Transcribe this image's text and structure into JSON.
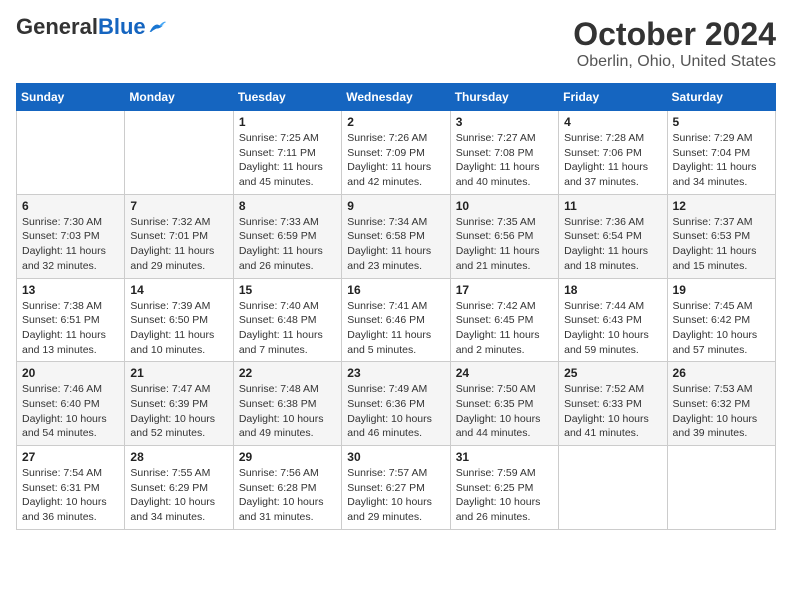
{
  "logo": {
    "general": "General",
    "blue": "Blue"
  },
  "title": "October 2024",
  "subtitle": "Oberlin, Ohio, United States",
  "weekdays": [
    "Sunday",
    "Monday",
    "Tuesday",
    "Wednesday",
    "Thursday",
    "Friday",
    "Saturday"
  ],
  "weeks": [
    [
      {
        "day": "",
        "info": ""
      },
      {
        "day": "",
        "info": ""
      },
      {
        "day": "1",
        "info": "Sunrise: 7:25 AM\nSunset: 7:11 PM\nDaylight: 11 hours\nand 45 minutes."
      },
      {
        "day": "2",
        "info": "Sunrise: 7:26 AM\nSunset: 7:09 PM\nDaylight: 11 hours\nand 42 minutes."
      },
      {
        "day": "3",
        "info": "Sunrise: 7:27 AM\nSunset: 7:08 PM\nDaylight: 11 hours\nand 40 minutes."
      },
      {
        "day": "4",
        "info": "Sunrise: 7:28 AM\nSunset: 7:06 PM\nDaylight: 11 hours\nand 37 minutes."
      },
      {
        "day": "5",
        "info": "Sunrise: 7:29 AM\nSunset: 7:04 PM\nDaylight: 11 hours\nand 34 minutes."
      }
    ],
    [
      {
        "day": "6",
        "info": "Sunrise: 7:30 AM\nSunset: 7:03 PM\nDaylight: 11 hours\nand 32 minutes."
      },
      {
        "day": "7",
        "info": "Sunrise: 7:32 AM\nSunset: 7:01 PM\nDaylight: 11 hours\nand 29 minutes."
      },
      {
        "day": "8",
        "info": "Sunrise: 7:33 AM\nSunset: 6:59 PM\nDaylight: 11 hours\nand 26 minutes."
      },
      {
        "day": "9",
        "info": "Sunrise: 7:34 AM\nSunset: 6:58 PM\nDaylight: 11 hours\nand 23 minutes."
      },
      {
        "day": "10",
        "info": "Sunrise: 7:35 AM\nSunset: 6:56 PM\nDaylight: 11 hours\nand 21 minutes."
      },
      {
        "day": "11",
        "info": "Sunrise: 7:36 AM\nSunset: 6:54 PM\nDaylight: 11 hours\nand 18 minutes."
      },
      {
        "day": "12",
        "info": "Sunrise: 7:37 AM\nSunset: 6:53 PM\nDaylight: 11 hours\nand 15 minutes."
      }
    ],
    [
      {
        "day": "13",
        "info": "Sunrise: 7:38 AM\nSunset: 6:51 PM\nDaylight: 11 hours\nand 13 minutes."
      },
      {
        "day": "14",
        "info": "Sunrise: 7:39 AM\nSunset: 6:50 PM\nDaylight: 11 hours\nand 10 minutes."
      },
      {
        "day": "15",
        "info": "Sunrise: 7:40 AM\nSunset: 6:48 PM\nDaylight: 11 hours\nand 7 minutes."
      },
      {
        "day": "16",
        "info": "Sunrise: 7:41 AM\nSunset: 6:46 PM\nDaylight: 11 hours\nand 5 minutes."
      },
      {
        "day": "17",
        "info": "Sunrise: 7:42 AM\nSunset: 6:45 PM\nDaylight: 11 hours\nand 2 minutes."
      },
      {
        "day": "18",
        "info": "Sunrise: 7:44 AM\nSunset: 6:43 PM\nDaylight: 10 hours\nand 59 minutes."
      },
      {
        "day": "19",
        "info": "Sunrise: 7:45 AM\nSunset: 6:42 PM\nDaylight: 10 hours\nand 57 minutes."
      }
    ],
    [
      {
        "day": "20",
        "info": "Sunrise: 7:46 AM\nSunset: 6:40 PM\nDaylight: 10 hours\nand 54 minutes."
      },
      {
        "day": "21",
        "info": "Sunrise: 7:47 AM\nSunset: 6:39 PM\nDaylight: 10 hours\nand 52 minutes."
      },
      {
        "day": "22",
        "info": "Sunrise: 7:48 AM\nSunset: 6:38 PM\nDaylight: 10 hours\nand 49 minutes."
      },
      {
        "day": "23",
        "info": "Sunrise: 7:49 AM\nSunset: 6:36 PM\nDaylight: 10 hours\nand 46 minutes."
      },
      {
        "day": "24",
        "info": "Sunrise: 7:50 AM\nSunset: 6:35 PM\nDaylight: 10 hours\nand 44 minutes."
      },
      {
        "day": "25",
        "info": "Sunrise: 7:52 AM\nSunset: 6:33 PM\nDaylight: 10 hours\nand 41 minutes."
      },
      {
        "day": "26",
        "info": "Sunrise: 7:53 AM\nSunset: 6:32 PM\nDaylight: 10 hours\nand 39 minutes."
      }
    ],
    [
      {
        "day": "27",
        "info": "Sunrise: 7:54 AM\nSunset: 6:31 PM\nDaylight: 10 hours\nand 36 minutes."
      },
      {
        "day": "28",
        "info": "Sunrise: 7:55 AM\nSunset: 6:29 PM\nDaylight: 10 hours\nand 34 minutes."
      },
      {
        "day": "29",
        "info": "Sunrise: 7:56 AM\nSunset: 6:28 PM\nDaylight: 10 hours\nand 31 minutes."
      },
      {
        "day": "30",
        "info": "Sunrise: 7:57 AM\nSunset: 6:27 PM\nDaylight: 10 hours\nand 29 minutes."
      },
      {
        "day": "31",
        "info": "Sunrise: 7:59 AM\nSunset: 6:25 PM\nDaylight: 10 hours\nand 26 minutes."
      },
      {
        "day": "",
        "info": ""
      },
      {
        "day": "",
        "info": ""
      }
    ]
  ]
}
